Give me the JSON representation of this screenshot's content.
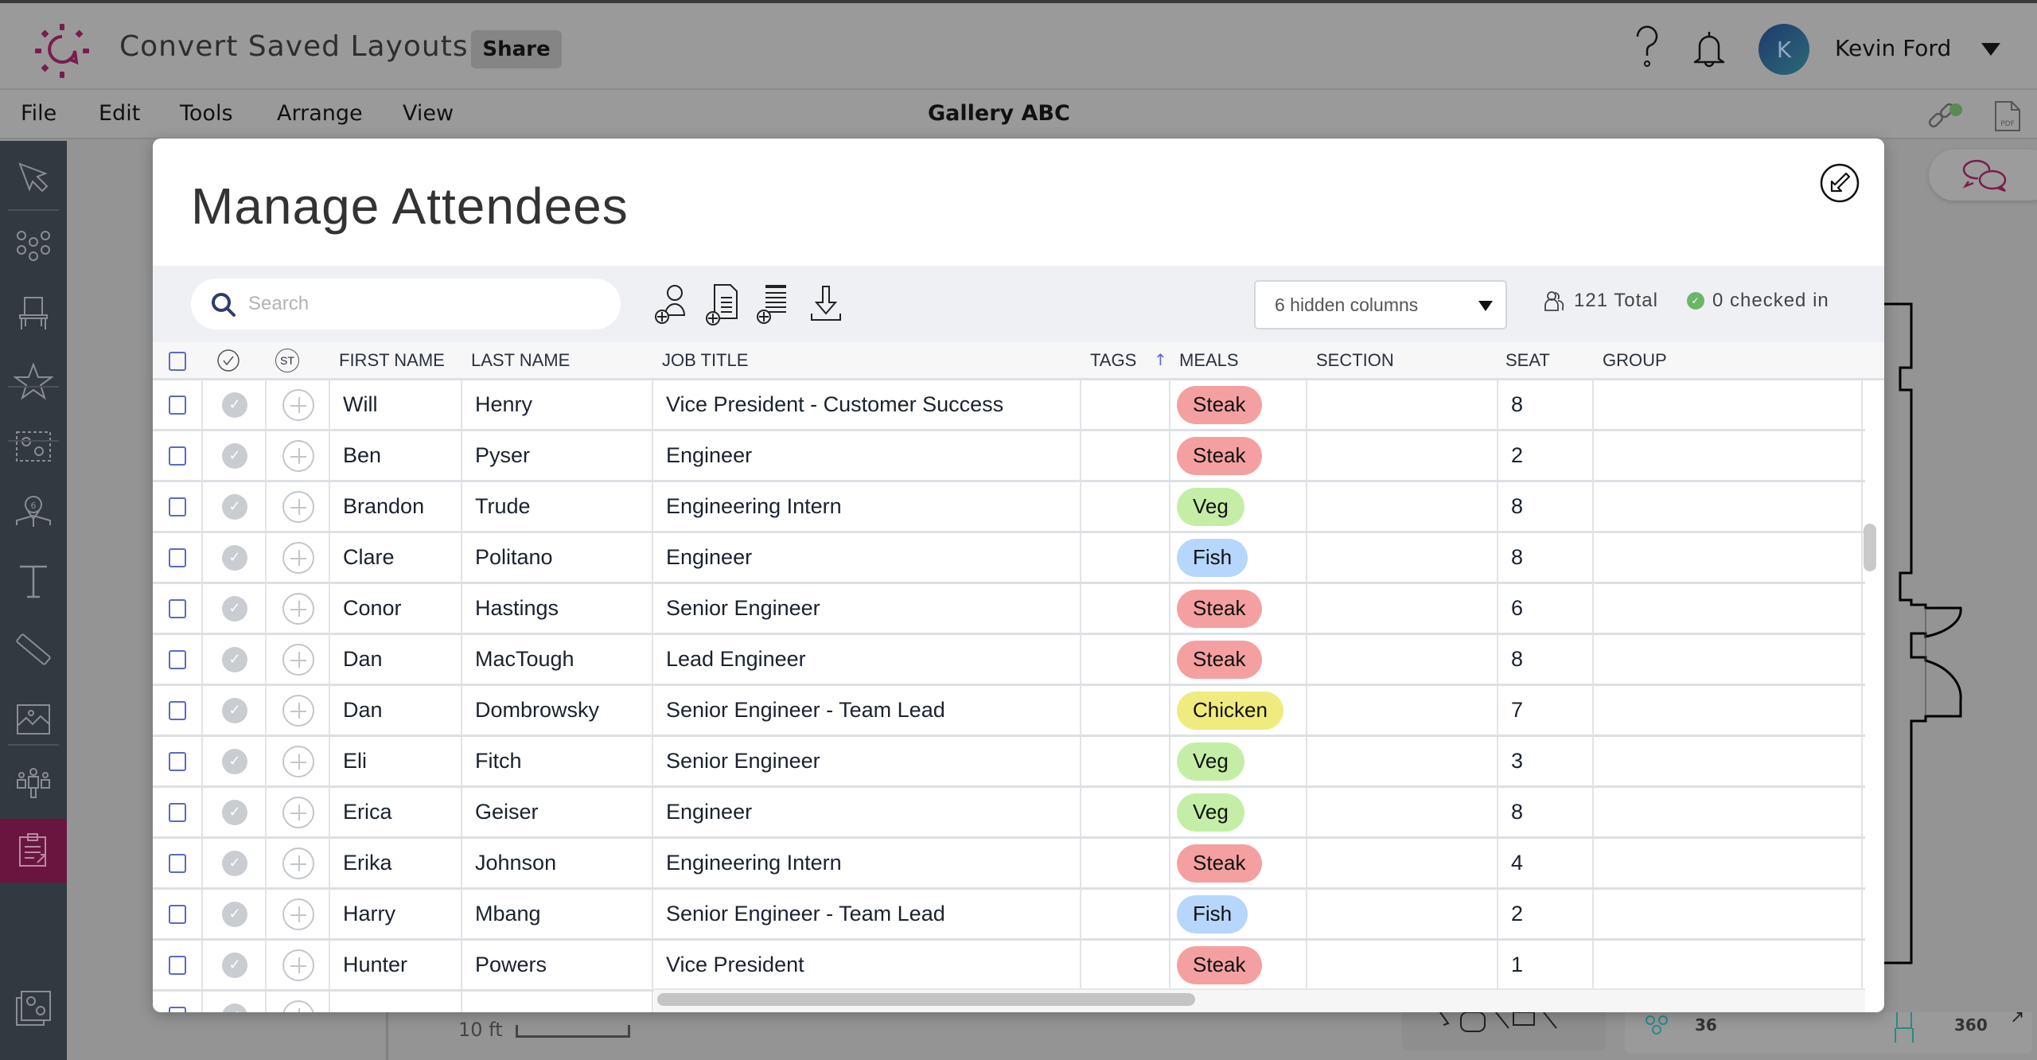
{
  "app": {
    "title": "Convert Saved Layouts",
    "share_label": "Share",
    "user": {
      "initial": "K",
      "name": "Kevin Ford"
    },
    "brand_color": "#7a1c4c"
  },
  "menu": {
    "items": [
      "File",
      "Edit",
      "Tools",
      "Arrange",
      "View"
    ],
    "document_title": "Gallery ABC"
  },
  "sidebar": {
    "items": [
      {
        "name": "select-tool",
        "icon": "cursor-icon"
      },
      {
        "name": "tables-tool",
        "icon": "round-tables-icon"
      },
      {
        "name": "chairs-tool",
        "icon": "chair-icon"
      },
      {
        "name": "favorites-tool",
        "icon": "star-icon"
      },
      {
        "name": "groups-tool",
        "icon": "table-group-icon"
      },
      {
        "name": "guest-count-tool",
        "icon": "map-pin-icon",
        "badge": "6"
      },
      {
        "name": "text-tool",
        "icon": "text-icon"
      },
      {
        "name": "measure-tool",
        "icon": "ruler-icon"
      },
      {
        "name": "image-tool",
        "icon": "image-icon"
      },
      {
        "name": "attendees-tool",
        "icon": "people-icon"
      },
      {
        "name": "manage-attendees-tool",
        "icon": "clipboard-icon",
        "active": true
      },
      {
        "name": "layouts-tool",
        "icon": "layouts-icon"
      }
    ]
  },
  "canvas": {
    "scale_label": "10 ft",
    "tables_count": "36",
    "seats_count": "360"
  },
  "modal": {
    "title": "Manage Attendees",
    "search_placeholder": "Search",
    "search_value": "",
    "hidden_columns_label": "6 hidden columns",
    "total_label": "121 Total",
    "checked_in_label": "0 checked in",
    "columns": {
      "first_name": "FIRST NAME",
      "last_name": "LAST NAME",
      "job_title": "JOB TITLE",
      "tags": "TAGS",
      "meals": "MEALS",
      "section": "SECTION",
      "seat": "SEAT",
      "group": "GROUP",
      "status_badge": "ST"
    },
    "meal_colors": {
      "Steak": "#f4a0a0",
      "Veg": "#c4eea6",
      "Fish": "#b6d6fb",
      "Chicken": "#efeb7e"
    },
    "rows": [
      {
        "first": "Will",
        "last": "Henry",
        "job": "Vice President - Customer Success",
        "tags": "",
        "meal": "Steak",
        "section": "",
        "seat": "8",
        "group": ""
      },
      {
        "first": "Ben",
        "last": "Pyser",
        "job": "Engineer",
        "tags": "",
        "meal": "Steak",
        "section": "",
        "seat": "2",
        "group": ""
      },
      {
        "first": "Brandon",
        "last": "Trude",
        "job": "Engineering Intern",
        "tags": "",
        "meal": "Veg",
        "section": "",
        "seat": "8",
        "group": ""
      },
      {
        "first": "Clare",
        "last": "Politano",
        "job": "Engineer",
        "tags": "",
        "meal": "Fish",
        "section": "",
        "seat": "8",
        "group": ""
      },
      {
        "first": "Conor",
        "last": "Hastings",
        "job": "Senior Engineer",
        "tags": "",
        "meal": "Steak",
        "section": "",
        "seat": "6",
        "group": ""
      },
      {
        "first": "Dan",
        "last": "MacTough",
        "job": "Lead Engineer",
        "tags": "",
        "meal": "Steak",
        "section": "",
        "seat": "8",
        "group": ""
      },
      {
        "first": "Dan",
        "last": "Dombrowsky",
        "job": "Senior Engineer - Team Lead",
        "tags": "",
        "meal": "Chicken",
        "section": "",
        "seat": "7",
        "group": ""
      },
      {
        "first": "Eli",
        "last": "Fitch",
        "job": "Senior Engineer",
        "tags": "",
        "meal": "Veg",
        "section": "",
        "seat": "3",
        "group": ""
      },
      {
        "first": "Erica",
        "last": "Geiser",
        "job": "Engineer",
        "tags": "",
        "meal": "Veg",
        "section": "",
        "seat": "8",
        "group": ""
      },
      {
        "first": "Erika",
        "last": "Johnson",
        "job": "Engineering Intern",
        "tags": "",
        "meal": "Steak",
        "section": "",
        "seat": "4",
        "group": ""
      },
      {
        "first": "Harry",
        "last": "Mbang",
        "job": "Senior Engineer - Team Lead",
        "tags": "",
        "meal": "Fish",
        "section": "",
        "seat": "2",
        "group": ""
      },
      {
        "first": "Hunter",
        "last": "Powers",
        "job": "Vice President",
        "tags": "",
        "meal": "Steak",
        "section": "",
        "seat": "1",
        "group": ""
      },
      {
        "first": "",
        "last": "",
        "job": "",
        "tags": "",
        "meal": "",
        "section": "",
        "seat": "",
        "group": ""
      }
    ]
  }
}
